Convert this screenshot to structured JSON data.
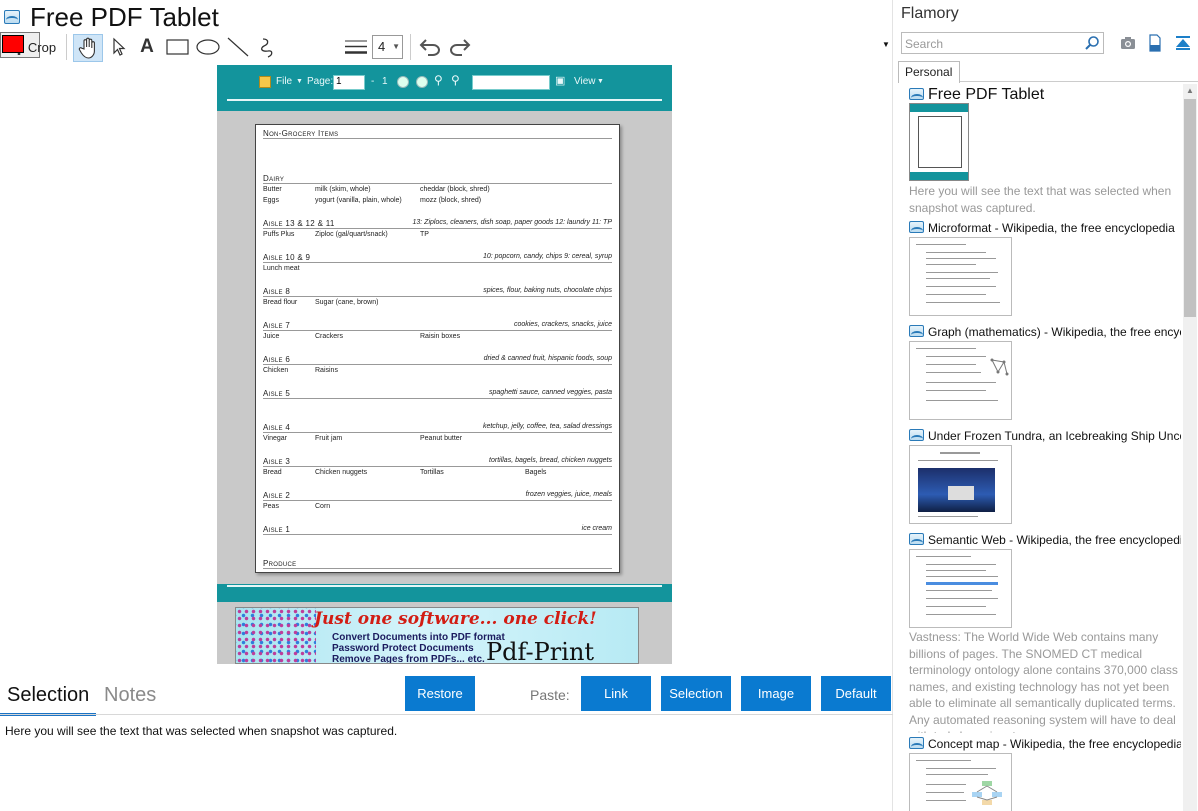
{
  "window": {
    "title": "Free PDF Tablet"
  },
  "toolbar": {
    "crop_label": "Crop",
    "text_tool": "A",
    "line_width": "4",
    "color": "#ff0000"
  },
  "pdf_viewer": {
    "file_label": "File",
    "page_label": "Page:",
    "page_value": "1",
    "page_sep": "-",
    "page_total": "1",
    "view_label": "View"
  },
  "document": {
    "sections": [
      {
        "heading": "Non-Grocery Items",
        "note": "",
        "rows": []
      },
      {
        "heading": "Dairy",
        "note": "",
        "rows": [
          [
            "Butter",
            "milk (skim, whole)",
            "cheddar (block, shred)",
            ""
          ],
          [
            "Eggs",
            "yogurt (vanilla, plain, whole)",
            "mozz (block, shred)",
            ""
          ]
        ]
      },
      {
        "heading": "Aisle 13 & 12 & 11",
        "note": "13: Ziplocs, cleaners, dish soap, paper goods 12: laundry 11: TP",
        "rows": [
          [
            "Puffs Plus",
            "Ziploc (gal/quart/snack)",
            "TP",
            ""
          ]
        ]
      },
      {
        "heading": "Aisle 10 & 9",
        "note": "10: popcorn, candy, chips 9: cereal, syrup",
        "rows": [
          [
            "Lunch meat",
            "",
            "",
            ""
          ]
        ]
      },
      {
        "heading": "Aisle 8",
        "note": "spices, flour, baking nuts, chocolate chips",
        "rows": [
          [
            "Bread flour",
            "Sugar (cane, brown)",
            "",
            ""
          ]
        ]
      },
      {
        "heading": "Aisle 7",
        "note": "cookies, crackers, snacks, juice",
        "rows": [
          [
            "Juice",
            "Crackers",
            "Raisin boxes",
            ""
          ]
        ]
      },
      {
        "heading": "Aisle 6",
        "note": "dried & canned fruit, hispanic foods, soup",
        "rows": [
          [
            "Chicken",
            "Raisins",
            "",
            ""
          ]
        ]
      },
      {
        "heading": "Aisle 5",
        "note": "spaghetti sauce, canned veggies, pasta",
        "rows": []
      },
      {
        "heading": "Aisle 4",
        "note": "ketchup, jelly, coffee, tea, salad dressings",
        "rows": [
          [
            "Vinegar",
            "Fruit jam",
            "Peanut butter",
            ""
          ]
        ]
      },
      {
        "heading": "Aisle 3",
        "note": "tortillas, bagels, bread, chicken nuggets",
        "rows": [
          [
            "Bread",
            "Chicken nuggets",
            "Tortillas",
            "Bagels"
          ]
        ]
      },
      {
        "heading": "Aisle 2",
        "note": "frozen veggies, juice, meals",
        "rows": [
          [
            "Peas",
            "Corn",
            "",
            ""
          ]
        ]
      },
      {
        "heading": "Aisle 1",
        "note": "ice cream",
        "rows": []
      },
      {
        "heading": "Produce",
        "note": "",
        "rows": []
      }
    ]
  },
  "banner": {
    "headline": "Just one software... one click!",
    "line1": "Convert Documents into PDF format",
    "line2": "Password Protect Documents",
    "line3": "Remove Pages from PDFs... etc.",
    "logo": "Pdf-Print"
  },
  "tabs": {
    "selection": "Selection",
    "notes": "Notes"
  },
  "buttons": {
    "restore": "Restore",
    "paste_label": "Paste:",
    "link": "Link",
    "selection": "Selection",
    "image": "Image",
    "default": "Default"
  },
  "selection_text": "Here you will see the text that was selected when snapshot was captured.",
  "sidebar": {
    "title": "Flamory",
    "search_placeholder": "Search",
    "tab": "Personal",
    "entries": [
      {
        "title": "Free PDF Tablet",
        "note": "Here you will see the text that was selected when snapshot was captured."
      },
      {
        "title": "Microformat - Wikipedia, the free encyclopedia",
        "note": ""
      },
      {
        "title": "Graph (mathematics) - Wikipedia, the free encyclopedia",
        "note": ""
      },
      {
        "title": "Under Frozen Tundra, an Icebreaking Ship Uncovers",
        "note": ""
      },
      {
        "title": "Semantic Web - Wikipedia, the free encyclopedia",
        "note": "Vastness: The World Wide Web contains many billions of pages. The SNOMED CT medical terminology ontology alone contains 370,000 class names, and existing technology has not yet been able to eliminate all semantically duplicated terms. Any automated reasoning system will have to deal with truly huge inputs."
      },
      {
        "title": "Concept map - Wikipedia, the free encyclopedia",
        "note": ""
      }
    ]
  }
}
